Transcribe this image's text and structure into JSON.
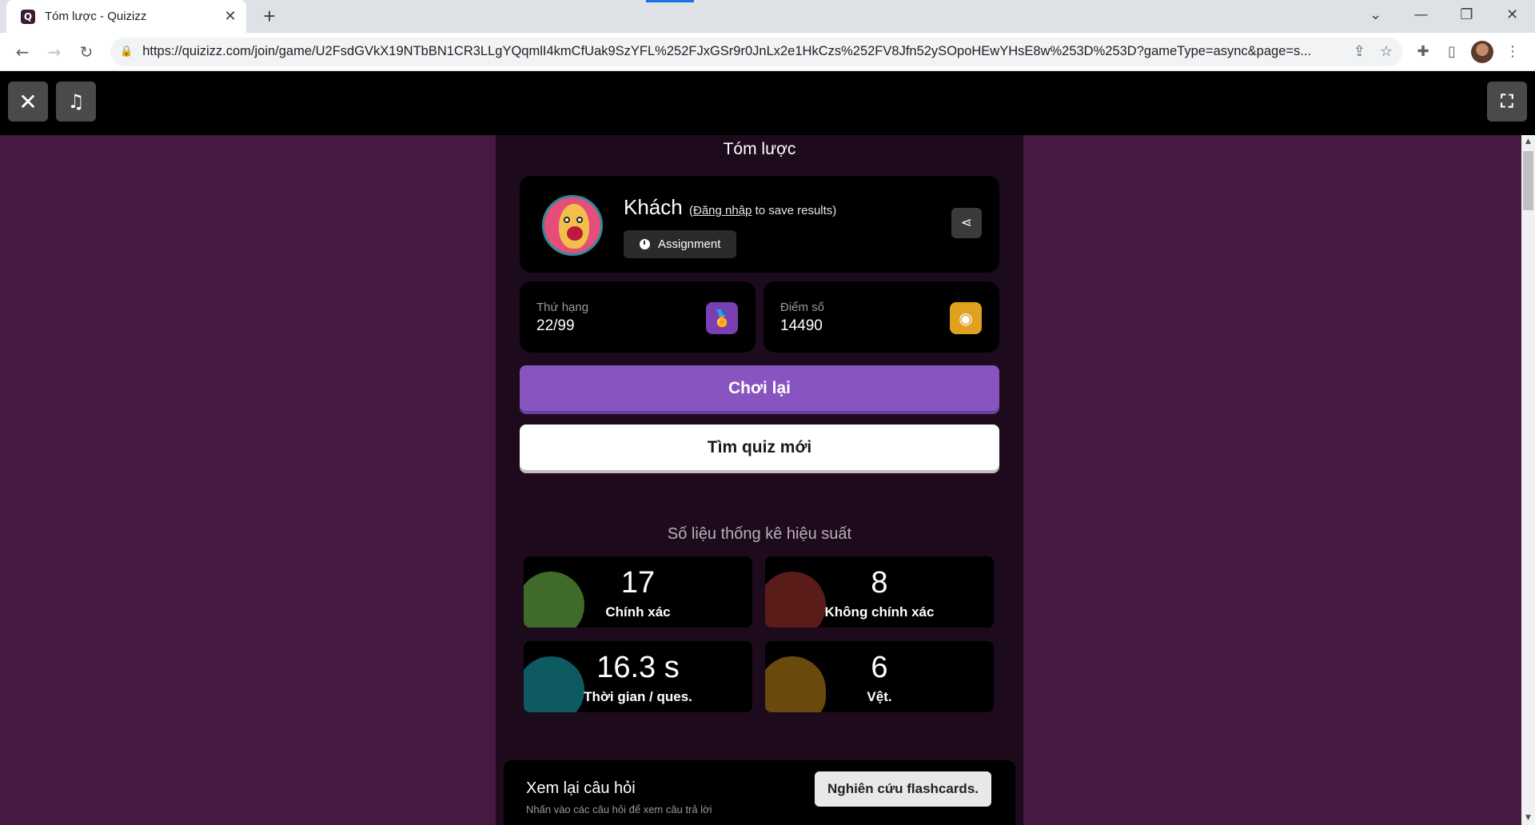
{
  "browser": {
    "tab_title": "Tóm lược - Quizizz",
    "url": "https://quizizz.com/join/game/U2FsdGVkX19NTbBN1CR3LLgYQqmlI4kmCfUak9SzYFL%252FJxGSr9r0JnLx2e1HkCzs%252FV8Jfn52ySOpoHEwYHsE8w%253D%253D?gameType=async&page=s..."
  },
  "page": {
    "heading": "Tóm lược",
    "player": {
      "name": "Khách",
      "login_link": "Đăng nhập",
      "login_suffix": "to save results)",
      "login_prefix": "(",
      "mode_badge": "Assignment"
    },
    "rank": {
      "label": "Thứ hạng",
      "value": "22/99"
    },
    "score": {
      "label": "Điểm số",
      "value": "14490"
    },
    "play_again": "Chơi lại",
    "find_quiz": "Tìm quiz mới",
    "perf_title": "Số liệu thống kê hiệu suất",
    "stats": {
      "correct": {
        "value": "17",
        "label": "Chính xác"
      },
      "incorrect": {
        "value": "8",
        "label": "Không chính xác"
      },
      "time": {
        "value": "16.3 s",
        "label": "Thời gian / ques."
      },
      "streak": {
        "value": "6",
        "label": "Vệt."
      }
    },
    "review": {
      "title": "Xem lại câu hỏi",
      "subtitle": "Nhấn vào các câu hỏi để xem câu trả lời",
      "flashcards": "Nghiên cứu flashcards."
    }
  },
  "colors": {
    "accent": "#8854c0",
    "stage_bg": "#461a42",
    "column_bg": "#1e0a1d",
    "rank_icon": "#7a3fb4",
    "score_icon": "#e0a020"
  }
}
